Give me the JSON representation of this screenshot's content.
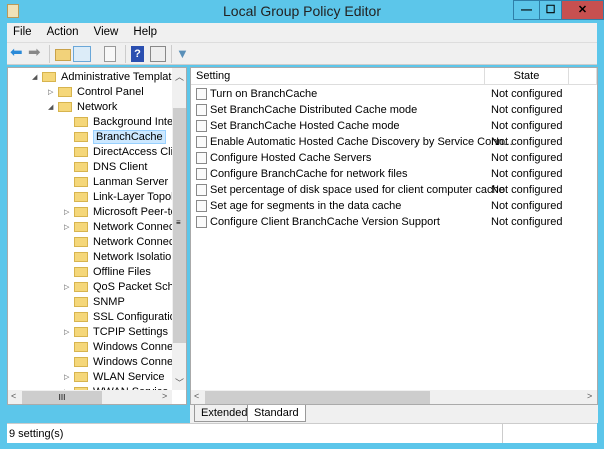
{
  "window": {
    "title": "Local Group Policy Editor",
    "minimize": "—",
    "maximize": "☐",
    "close": "✕"
  },
  "menu": [
    "File",
    "Action",
    "View",
    "Help"
  ],
  "toolbar_icons": [
    "back-icon",
    "forward-icon",
    "up-folder-icon",
    "show-hide-tree-icon",
    "export-list-icon",
    "help-icon",
    "show-action-pane-icon",
    "filter-icon"
  ],
  "tree": [
    {
      "label": "Administrative Templates",
      "level": 0,
      "expander": "◢"
    },
    {
      "label": "Control Panel",
      "level": 1,
      "expander": "▷"
    },
    {
      "label": "Network",
      "level": 1,
      "expander": "◢"
    },
    {
      "label": "Background Intelli",
      "level": 2,
      "expander": ""
    },
    {
      "label": "BranchCache",
      "level": 2,
      "expander": "",
      "selected": true
    },
    {
      "label": "DirectAccess Clien",
      "level": 2,
      "expander": ""
    },
    {
      "label": "DNS Client",
      "level": 2,
      "expander": ""
    },
    {
      "label": "Lanman Server",
      "level": 2,
      "expander": ""
    },
    {
      "label": "Link-Layer Topolo",
      "level": 2,
      "expander": ""
    },
    {
      "label": "Microsoft Peer-to-",
      "level": 2,
      "expander": "▷"
    },
    {
      "label": "Network Connecti",
      "level": 2,
      "expander": "▷"
    },
    {
      "label": "Network Connecti",
      "level": 2,
      "expander": ""
    },
    {
      "label": "Network Isolation",
      "level": 2,
      "expander": ""
    },
    {
      "label": "Offline Files",
      "level": 2,
      "expander": ""
    },
    {
      "label": "QoS Packet Sched",
      "level": 2,
      "expander": "▷"
    },
    {
      "label": "SNMP",
      "level": 2,
      "expander": ""
    },
    {
      "label": "SSL Configuration",
      "level": 2,
      "expander": ""
    },
    {
      "label": "TCPIP Settings",
      "level": 2,
      "expander": "▷"
    },
    {
      "label": "Windows Connect",
      "level": 2,
      "expander": ""
    },
    {
      "label": "Windows Connect",
      "level": 2,
      "expander": ""
    },
    {
      "label": "WLAN Service",
      "level": 2,
      "expander": "▷"
    },
    {
      "label": "WWAN Service",
      "level": 2,
      "expander": "▷"
    }
  ],
  "list": {
    "columns": [
      "Setting",
      "State"
    ],
    "rows": [
      {
        "setting": "Turn on BranchCache",
        "state": "Not configured"
      },
      {
        "setting": "Set BranchCache Distributed Cache mode",
        "state": "Not configured"
      },
      {
        "setting": "Set BranchCache Hosted Cache mode",
        "state": "Not configured"
      },
      {
        "setting": "Enable Automatic Hosted Cache Discovery by Service Conn...",
        "state": "Not configured"
      },
      {
        "setting": "Configure Hosted Cache Servers",
        "state": "Not configured"
      },
      {
        "setting": "Configure BranchCache for network files",
        "state": "Not configured"
      },
      {
        "setting": "Set percentage of disk space used for client computer cache",
        "state": "Not configured"
      },
      {
        "setting": "Set age for segments in the data cache",
        "state": "Not configured"
      },
      {
        "setting": "Configure Client BranchCache Version Support",
        "state": "Not configured"
      }
    ]
  },
  "tabs": [
    "Extended",
    "Standard"
  ],
  "active_tab": "Standard",
  "status": "9 setting(s)"
}
